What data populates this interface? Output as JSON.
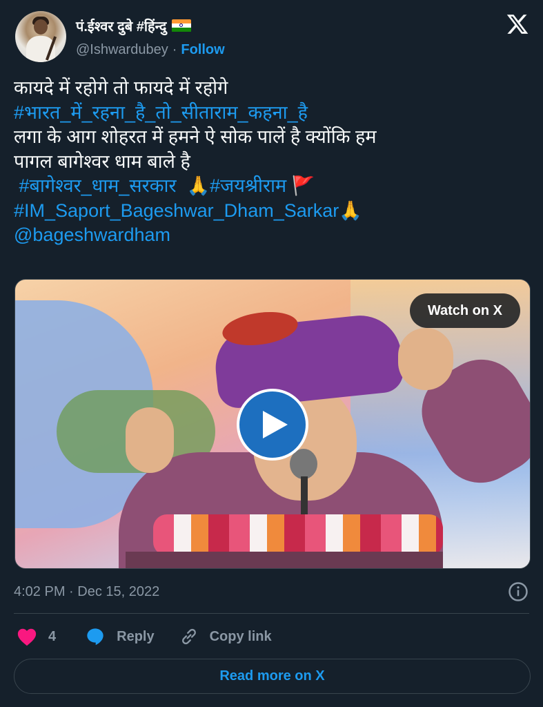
{
  "author": {
    "display_name": "पं.ईश्वर दुबे #हिंन्दु",
    "handle": "@Ishwardubey",
    "separator": "·",
    "follow_label": "Follow",
    "flag_icon": "india-flag-icon"
  },
  "tweet": {
    "lines": [
      {
        "text": "कायदे में रहोगे तो फायदे में रहोगे",
        "kind": "text"
      },
      {
        "text": "#भारत_में_रहना_है_तो_सीताराम_कहना_है",
        "kind": "tag"
      },
      {
        "text": "लगा के आग शोहरत में हमने ऐ सोक पालें है क्योंकि हम",
        "kind": "text"
      },
      {
        "text": "पागल बागेश्वर धाम बाले है",
        "kind": "text"
      },
      {
        "text": " #बागेश्वर_धाम_सरकार ",
        "kind": "tag"
      },
      {
        "text": "🙏",
        "kind": "emoji"
      },
      {
        "text": "#जयश्रीराम",
        "kind": "tag"
      },
      {
        "text": "🚩",
        "kind": "emoji"
      },
      {
        "text": "#IM_Saport_Bageshwar_Dham_Sarkar",
        "kind": "tag"
      },
      {
        "text": "🙏",
        "kind": "emoji"
      },
      {
        "text": "@bageshwardham",
        "kind": "tag"
      }
    ]
  },
  "media": {
    "watch_label": "Watch on X",
    "play_icon": "play-icon"
  },
  "meta": {
    "timestamp": "4:02 PM · Dec 15, 2022",
    "info_icon": "info-icon"
  },
  "actions": {
    "like_count": "4",
    "reply_label": "Reply",
    "copy_label": "Copy link"
  },
  "footer": {
    "read_more_label": "Read more on X"
  },
  "colors": {
    "background": "#15202b",
    "accent": "#1d9bf0",
    "muted": "#8b98a5",
    "like": "#f91880"
  }
}
